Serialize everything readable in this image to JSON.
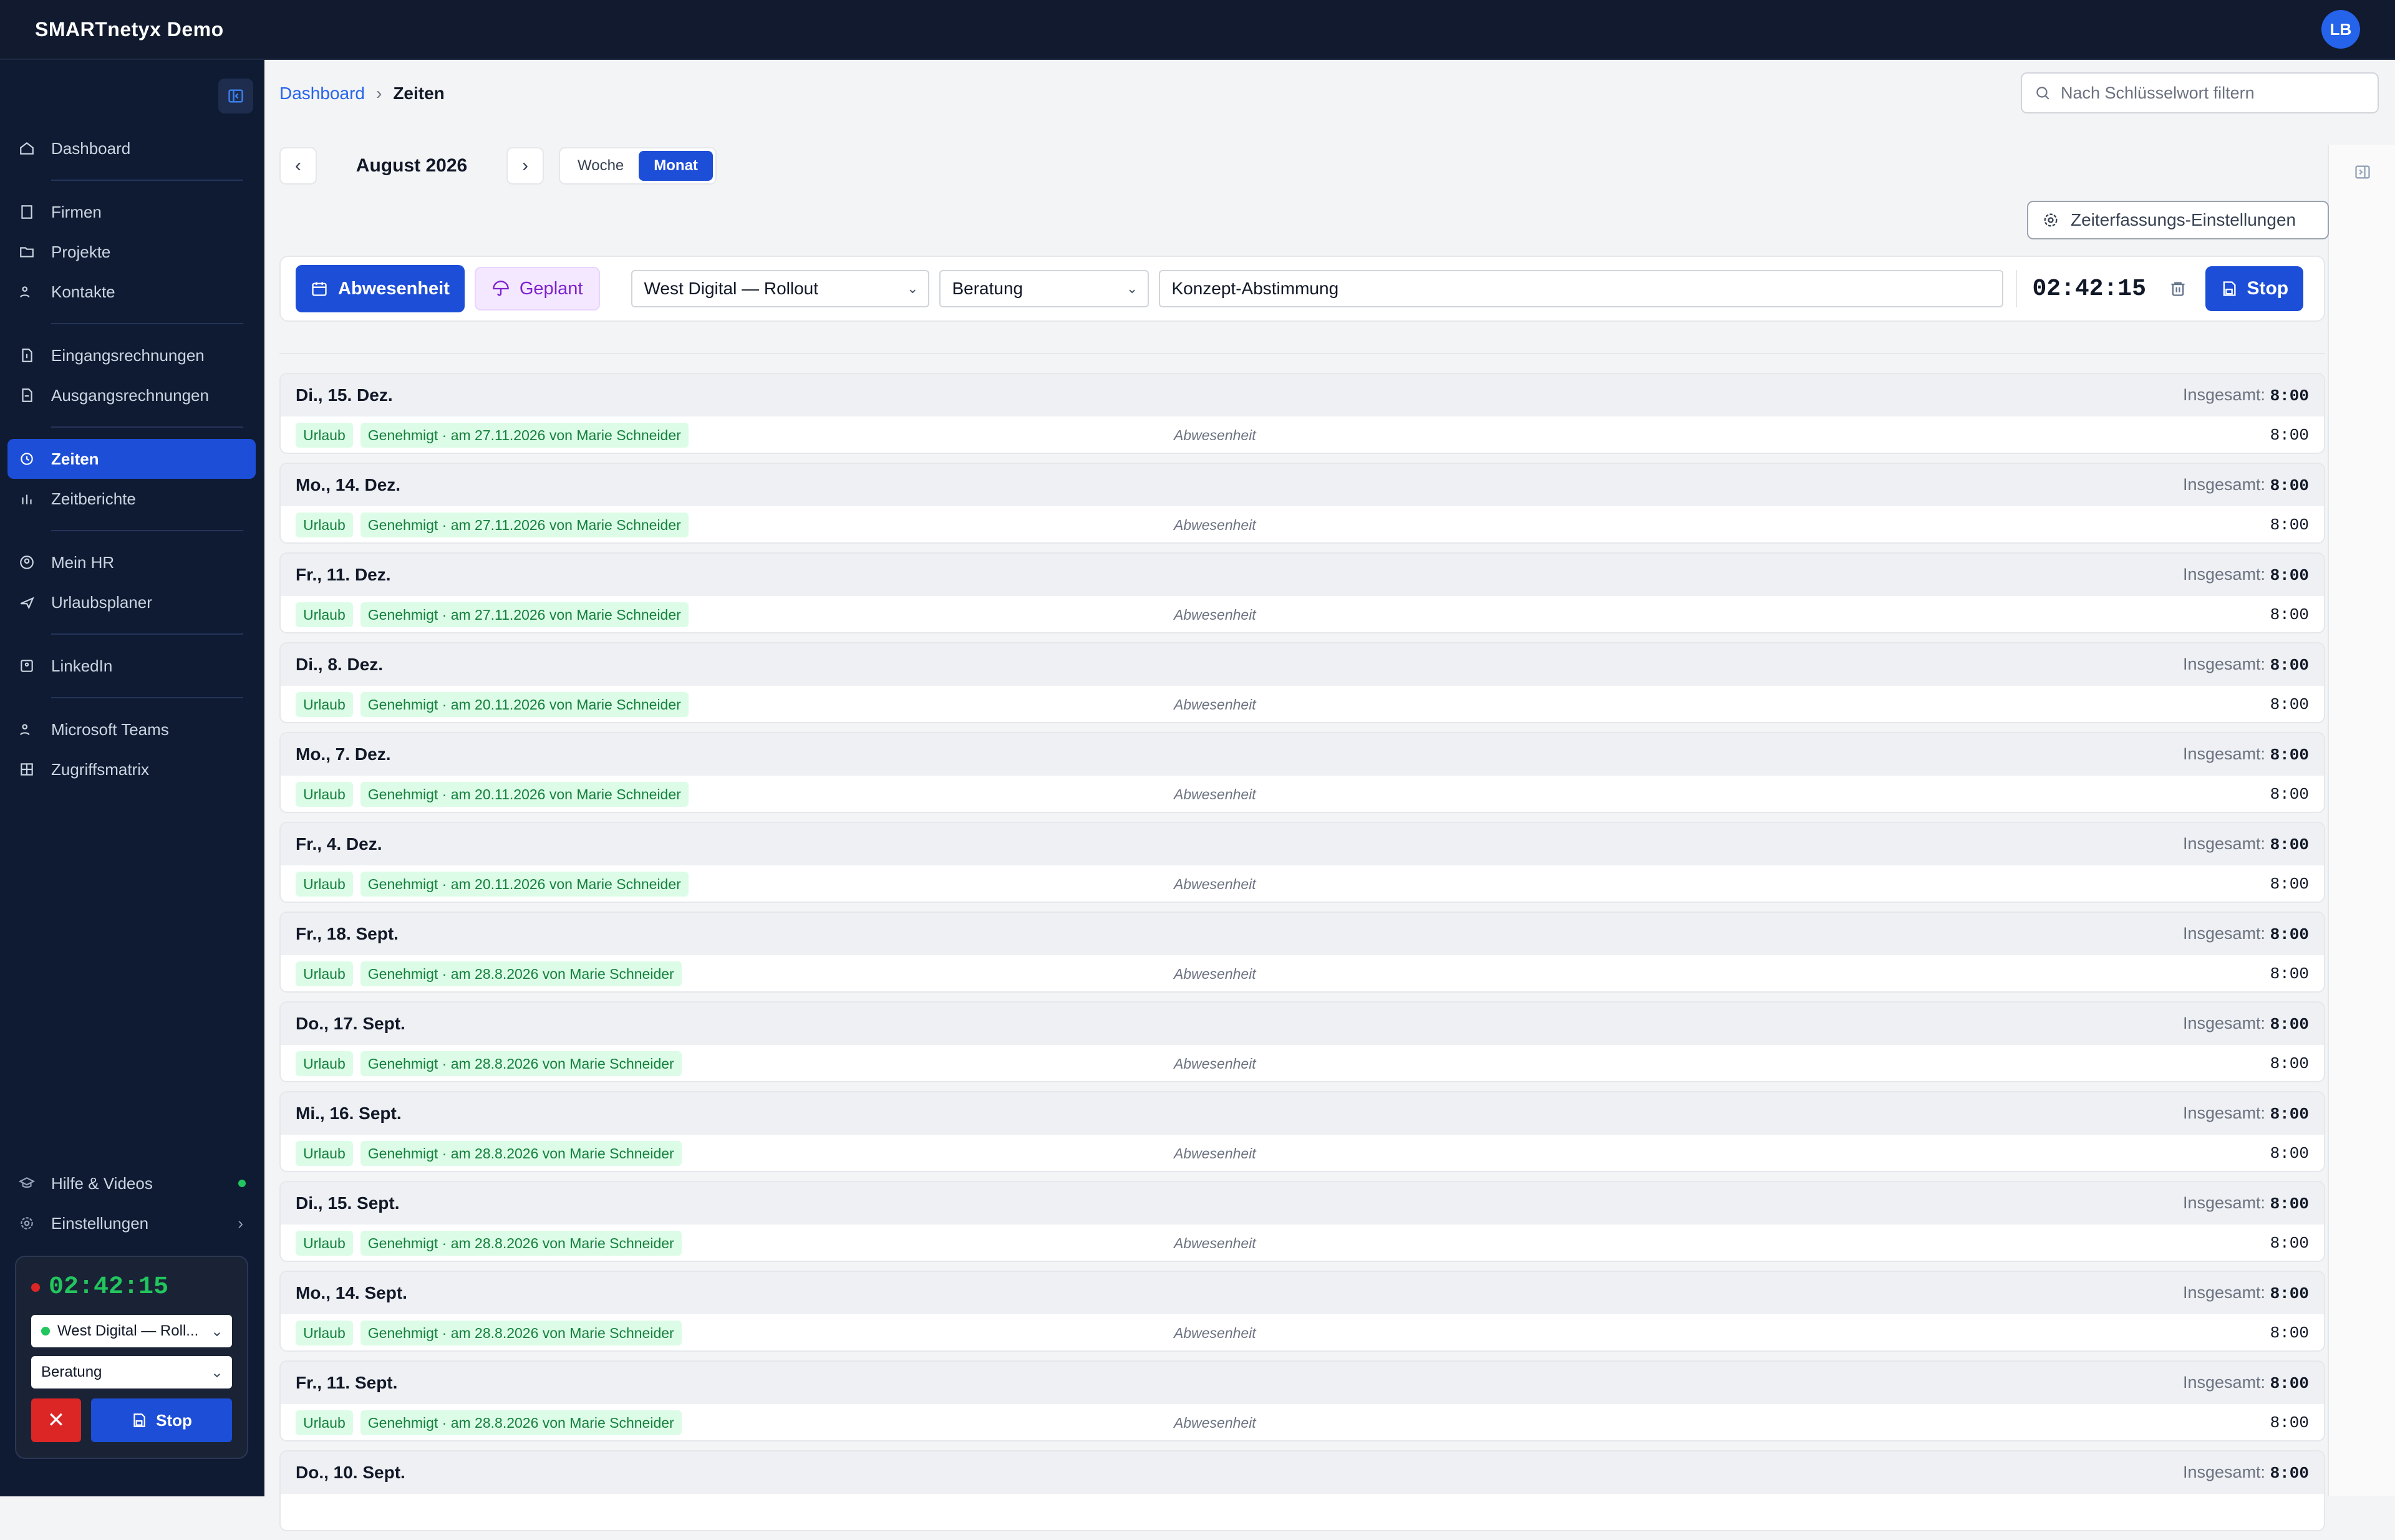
{
  "app": {
    "title": "SMARTnetyx Demo",
    "user_initials": "LB"
  },
  "sidebar": {
    "groups": [
      [
        {
          "label": "Dashboard",
          "icon": "home-icon"
        }
      ],
      [
        {
          "label": "Firmen",
          "icon": "building-icon"
        },
        {
          "label": "Projekte",
          "icon": "folder-icon"
        },
        {
          "label": "Kontakte",
          "icon": "users-icon"
        }
      ],
      [
        {
          "label": "Eingangsrechnungen",
          "icon": "invoice-in-icon"
        },
        {
          "label": "Ausgangsrechnungen",
          "icon": "invoice-out-icon"
        }
      ],
      [
        {
          "label": "Zeiten",
          "icon": "clock-icon",
          "active": true
        },
        {
          "label": "Zeitberichte",
          "icon": "bar-chart-icon"
        }
      ],
      [
        {
          "label": "Mein HR",
          "icon": "user-circle-icon"
        },
        {
          "label": "Urlaubsplaner",
          "icon": "plane-icon"
        }
      ],
      [
        {
          "label": "LinkedIn",
          "icon": "linkedin-icon"
        }
      ],
      [
        {
          "label": "Microsoft Teams",
          "icon": "teams-icon"
        },
        {
          "label": "Zugriffsmatrix",
          "icon": "grid-icon"
        }
      ]
    ],
    "bottom": {
      "help": "Hilfe & Videos",
      "settings": "Einstellungen"
    },
    "mini_timer": {
      "time": "02:42:15",
      "project": "West Digital — Roll...",
      "activity": "Beratung",
      "stop_label": "Stop",
      "cancel_label": "✕"
    }
  },
  "breadcrumb": {
    "home": "Dashboard",
    "current": "Zeiten"
  },
  "search": {
    "placeholder": "Nach Schlüsselwort filtern"
  },
  "period": {
    "label": "August 2026",
    "views": [
      "Woche",
      "Monat"
    ],
    "active_view": "Monat"
  },
  "settings_button": "Zeiterfassungs-Einstellungen",
  "entry": {
    "absence_label": "Abwesenheit",
    "planned_label": "Geplant",
    "project": "West Digital — Rollout",
    "activity": "Beratung",
    "description": "Konzept-Abstimmung",
    "timer": "02:42:15",
    "stop_label": "Stop"
  },
  "days_total_label": "Insgesamt:",
  "days": [
    {
      "date": "Di., 15. Dez.",
      "total": "8:00",
      "type": "Urlaub",
      "status": "Genehmigt · am 27.11.2026 von Marie Schneider",
      "kind": "Abwesenheit",
      "hours": "8:00"
    },
    {
      "date": "Mo., 14. Dez.",
      "total": "8:00",
      "type": "Urlaub",
      "status": "Genehmigt · am 27.11.2026 von Marie Schneider",
      "kind": "Abwesenheit",
      "hours": "8:00"
    },
    {
      "date": "Fr., 11. Dez.",
      "total": "8:00",
      "type": "Urlaub",
      "status": "Genehmigt · am 27.11.2026 von Marie Schneider",
      "kind": "Abwesenheit",
      "hours": "8:00"
    },
    {
      "date": "Di., 8. Dez.",
      "total": "8:00",
      "type": "Urlaub",
      "status": "Genehmigt · am 20.11.2026 von Marie Schneider",
      "kind": "Abwesenheit",
      "hours": "8:00"
    },
    {
      "date": "Mo., 7. Dez.",
      "total": "8:00",
      "type": "Urlaub",
      "status": "Genehmigt · am 20.11.2026 von Marie Schneider",
      "kind": "Abwesenheit",
      "hours": "8:00"
    },
    {
      "date": "Fr., 4. Dez.",
      "total": "8:00",
      "type": "Urlaub",
      "status": "Genehmigt · am 20.11.2026 von Marie Schneider",
      "kind": "Abwesenheit",
      "hours": "8:00"
    },
    {
      "date": "Fr., 18. Sept.",
      "total": "8:00",
      "type": "Urlaub",
      "status": "Genehmigt · am 28.8.2026 von Marie Schneider",
      "kind": "Abwesenheit",
      "hours": "8:00"
    },
    {
      "date": "Do., 17. Sept.",
      "total": "8:00",
      "type": "Urlaub",
      "status": "Genehmigt · am 28.8.2026 von Marie Schneider",
      "kind": "Abwesenheit",
      "hours": "8:00"
    },
    {
      "date": "Mi., 16. Sept.",
      "total": "8:00",
      "type": "Urlaub",
      "status": "Genehmigt · am 28.8.2026 von Marie Schneider",
      "kind": "Abwesenheit",
      "hours": "8:00"
    },
    {
      "date": "Di., 15. Sept.",
      "total": "8:00",
      "type": "Urlaub",
      "status": "Genehmigt · am 28.8.2026 von Marie Schneider",
      "kind": "Abwesenheit",
      "hours": "8:00"
    },
    {
      "date": "Mo., 14. Sept.",
      "total": "8:00",
      "type": "Urlaub",
      "status": "Genehmigt · am 28.8.2026 von Marie Schneider",
      "kind": "Abwesenheit",
      "hours": "8:00"
    },
    {
      "date": "Fr., 11. Sept.",
      "total": "8:00",
      "type": "Urlaub",
      "status": "Genehmigt · am 28.8.2026 von Marie Schneider",
      "kind": "Abwesenheit",
      "hours": "8:00"
    },
    {
      "date": "Do., 10. Sept.",
      "total": "8:00",
      "type": "",
      "status": "",
      "kind": "",
      "hours": ""
    }
  ]
}
